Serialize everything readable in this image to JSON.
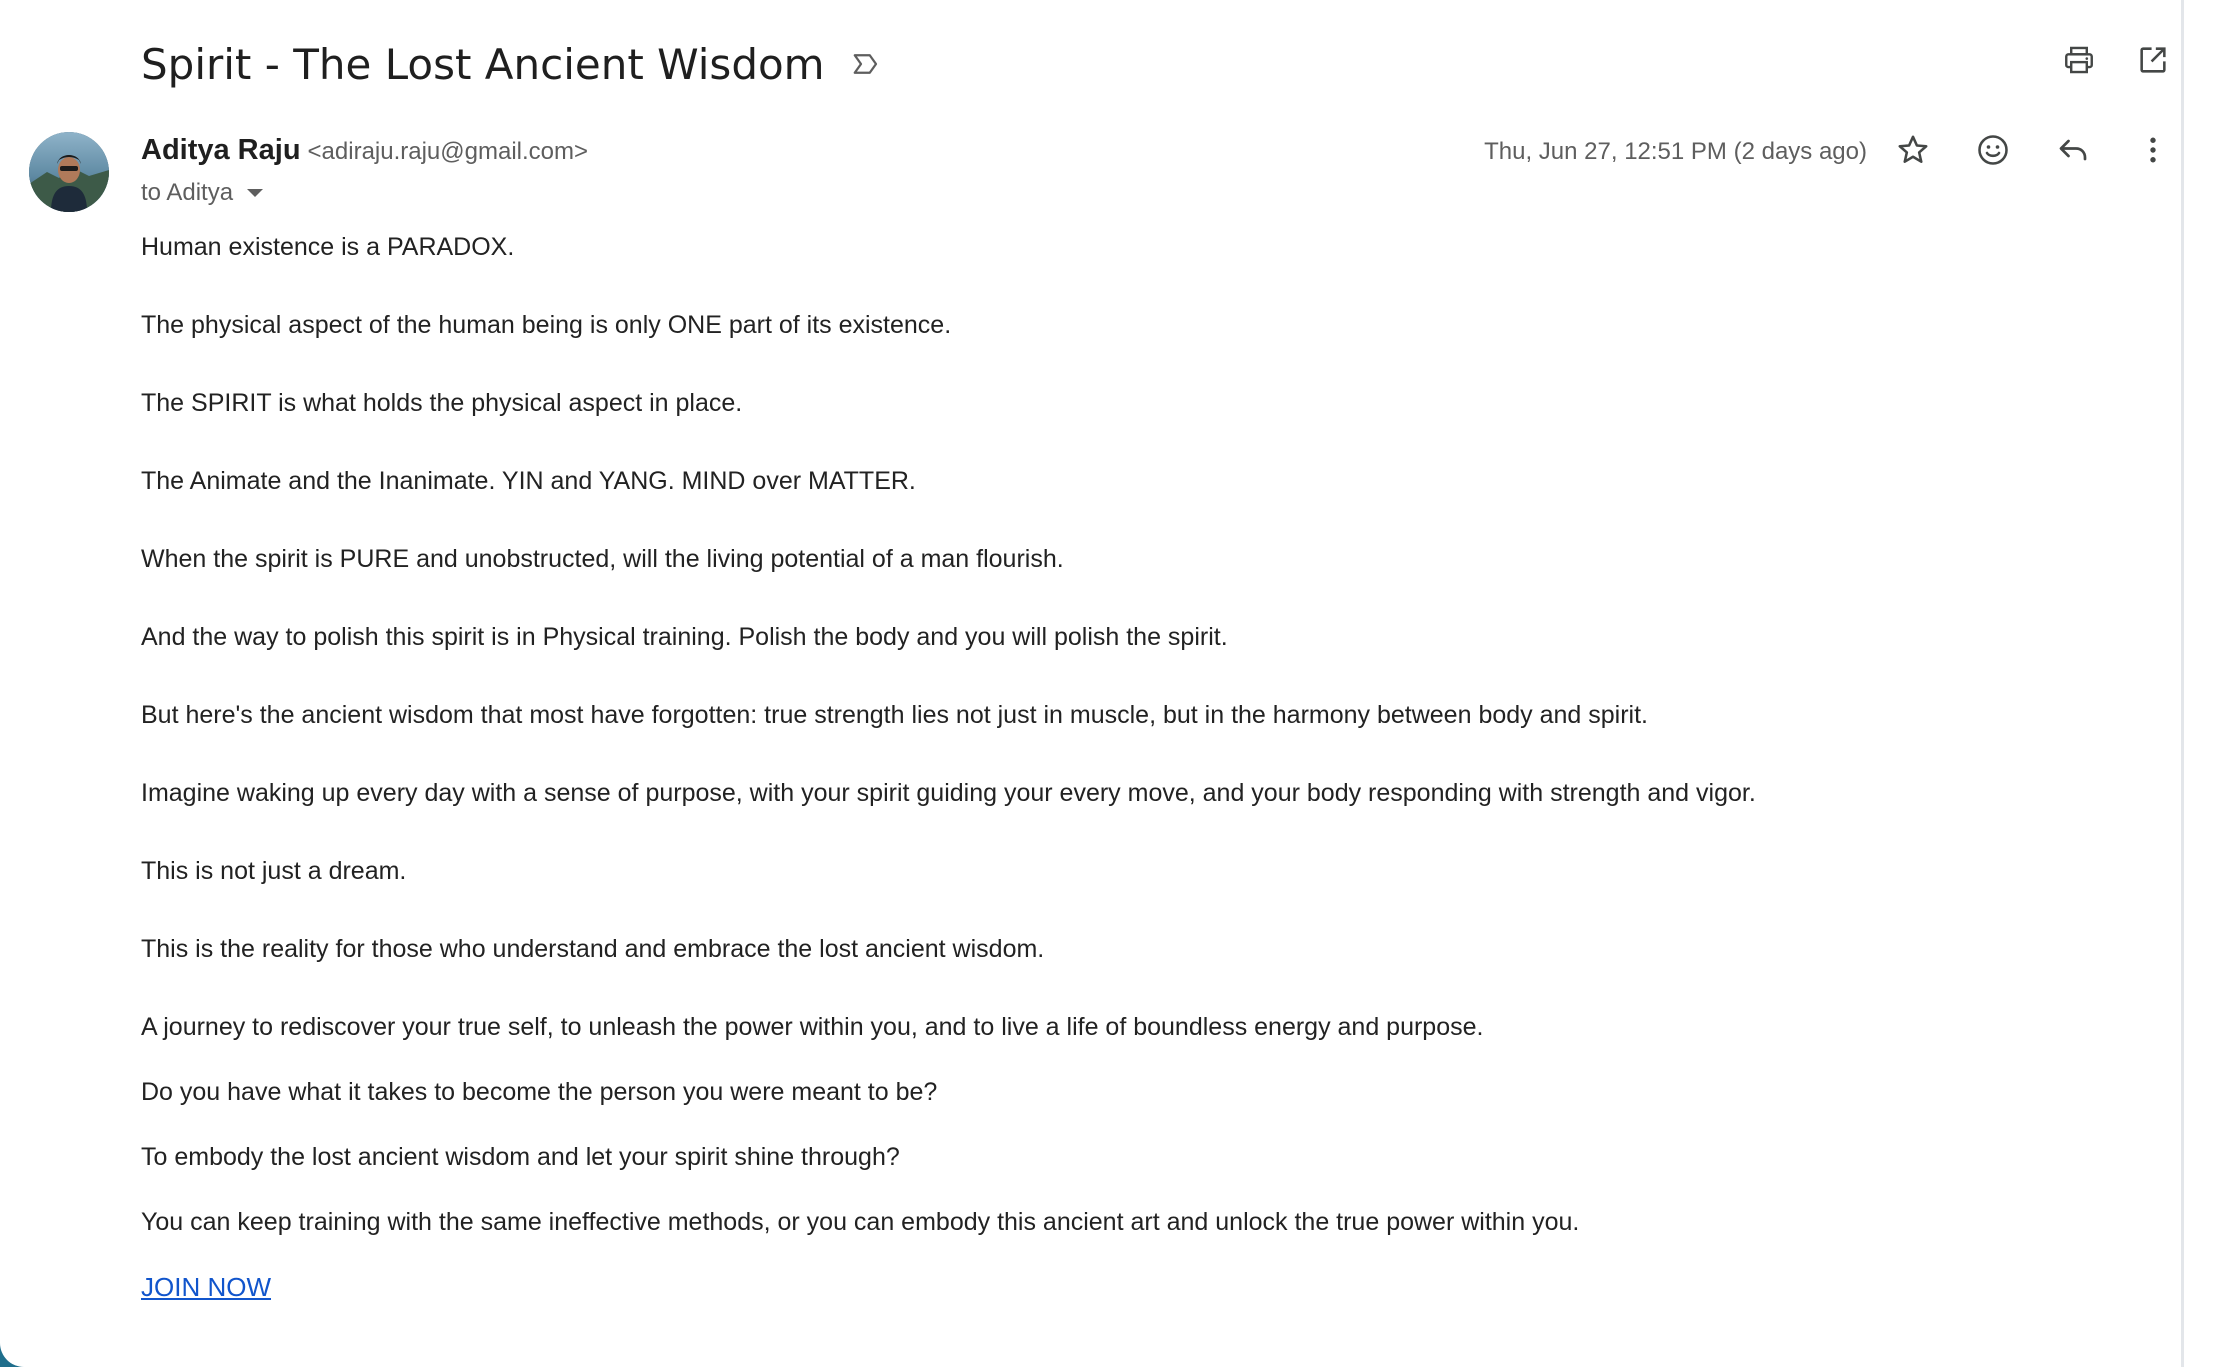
{
  "email": {
    "subject": "Spirit - The Lost Ancient Wisdom",
    "sender": {
      "name": "Aditya Raju",
      "email": "<adiraju.raju@gmail.com>"
    },
    "recipient_line": "to Aditya",
    "date": "Thu, Jun 27, 12:51 PM (2 days ago)",
    "body_paragraphs": [
      "Human existence is a PARADOX.",
      "The physical aspect of the human being is only ONE part of its existence.",
      "The SPIRIT is what holds the physical aspect in place.",
      "The Animate and the Inanimate. YIN and YANG. MIND over MATTER.",
      "When the spirit is PURE and unobstructed, will the living potential of a man flourish.",
      "And the way to polish this spirit is in Physical training. Polish the body and you will polish the spirit.",
      "But here's the ancient wisdom that most have forgotten: true strength lies not just in muscle, but in the harmony between body and spirit.",
      "Imagine waking up every day with a sense of purpose, with your spirit guiding your every move, and your body responding with strength and vigor.",
      "This is not just a dream.",
      "This is the reality for those who understand and embrace the lost ancient wisdom.",
      "A journey to rediscover your true self, to unleash the power within you, and to live a life of boundless energy and purpose.",
      "Do you have what it takes to become the person you were meant to be?",
      "To embody the lost ancient wisdom and let your spirit shine through?",
      "You can keep training with the same ineffective methods, or you can embody this ancient art and unlock the true power within you."
    ],
    "cta_link": "JOIN NOW"
  },
  "icons": {
    "label": "label-outline-icon",
    "print": "print-icon",
    "open_new_window": "open-in-new-icon",
    "star": "star-outline-icon",
    "emoji": "emoji-reaction-icon",
    "reply": "reply-icon",
    "more": "more-vert-icon",
    "recipient_caret": "caret-down-icon"
  },
  "colors": {
    "link": "#1155cc",
    "meta_text": "#5e5e5e",
    "body_text": "#222222"
  }
}
